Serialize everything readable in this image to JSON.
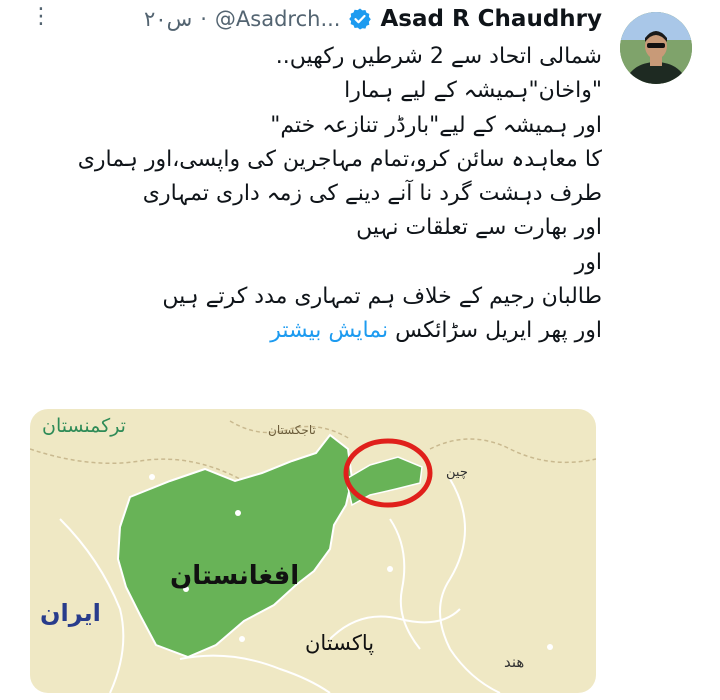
{
  "tweet": {
    "display_name": "Asad R Chaudhry",
    "handle": "@Asadrch...",
    "separator": "·",
    "timestamp": "۲۰س",
    "more_icon": "more-horizontal-icon",
    "verified_icon": "verified-badge-icon",
    "verified_color": "#1d9bf0",
    "lines": [
      "شمالی اتحاد سے 2 شرطیں رکھیں..",
      "\"واخان\"ہمیشہ کے لیے ہمارا",
      "اور ہمیشہ کے لیے\"بارڈر تنازعہ ختم\"",
      "کا معاہدہ سائن کرو،تمام مہاجرین کی واپسی،اور ہماری",
      "طرف دہشت گرد نا آنے دینے کی زمہ داری تمہاری",
      "اور بھارت سے تعلقات نہیں",
      "اور",
      "طالبان رجیم کے خلاف ہم تمہاری مدد کرتے ہیں"
    ],
    "last_line": "اور پھر ایریل سڑائکس",
    "show_more": "نمایش بیشتر",
    "link_color": "#1d9bf0"
  },
  "map": {
    "labels": {
      "afghanistan": "افغانستان",
      "pakistan": "پاکستان",
      "iran": "ایران",
      "turkmenistan": "ترکمنستان",
      "tajikistan": "تاجکستان",
      "china": "چین",
      "india": "ھند"
    },
    "colors": {
      "land": "#efe8c4",
      "afghanistan": "#68b357",
      "highlight_circle": "#e0201b"
    }
  }
}
